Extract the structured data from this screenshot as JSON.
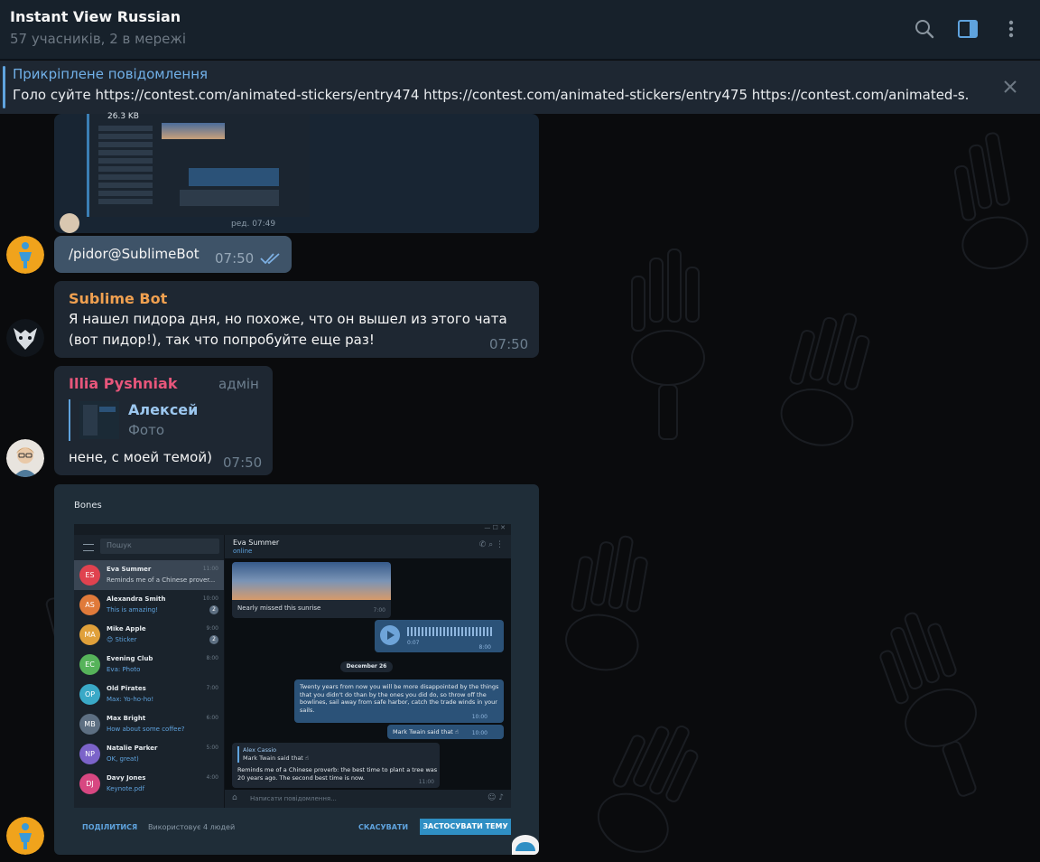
{
  "header": {
    "title": "Instant View Russian",
    "subtitle": "57 учасників, 2 в мережі"
  },
  "pinned": {
    "title": "Прикріплене повідомлення",
    "text": "Голо суйте https://contest.com/animated-stickers/entry474 https://contest.com/animated-stickers/entry475 https://contest.com/animated-s..."
  },
  "top_preview": {
    "size": "26.3 KB",
    "time": "ред. 07:49"
  },
  "messages": {
    "cmd": {
      "text": "/pidor@SublimeBot",
      "time": "07:50"
    },
    "bot": {
      "sender": "Sublime Bot",
      "line1": "Я нашел пидора дня, но похоже, что он вышел из этого чата",
      "line2": "(вот пидор!), так что попробуйте еще раз!",
      "time": "07:50"
    },
    "illia": {
      "sender": "Illia Pyshniak",
      "role": "адмін",
      "reply_name": "Алексей",
      "reply_text": "Фото",
      "text": "нене, с моей темой)",
      "time": "07:50"
    }
  },
  "theme": {
    "name": "Bones",
    "chat_name": "Eva Summer",
    "chat_status": "online",
    "search": "Пошук",
    "compose": "Написати повідомлення...",
    "share": "ПОДІЛИТИСЯ",
    "uses": "Використовує 4 людей",
    "cancel": "СКАСУВАТИ",
    "apply": "ЗАСТОСУВАТИ ТЕМУ",
    "photo_caption": "Nearly missed this sunrise",
    "photo_time": "7:00",
    "voice_len": "0:07",
    "voice_time": "8:00",
    "date": "December 26",
    "long_msg": [
      "Twenty years from now you will be more disappointed by the things",
      "that you didn't do than by the ones you did do, so throw off the",
      "bowlines, sail away from safe harbor, catch the trade winds in your",
      "sails."
    ],
    "long_time": "10:00",
    "mt_msg": "Mark Twain said that ☝",
    "mt_time": "10:00",
    "reply_author": "Alex Cassio",
    "reply_quote": "Mark Twain said that ☝",
    "reply_lines": [
      "Reminds me of a Chinese proverb: the best time to plant a tree was",
      "20 years ago. The second best time is now."
    ],
    "reply_time": "11:00",
    "chats": [
      {
        "initials": "ES",
        "name": "Eva Summer",
        "preview": "Reminds me of a Chinese prover...",
        "time": "11:00",
        "color": "#e0424f",
        "badge": ""
      },
      {
        "initials": "AS",
        "name": "Alexandra Smith",
        "preview": "This is amazing!",
        "time": "10:00",
        "color": "#e07a3a",
        "badge": "2"
      },
      {
        "initials": "MA",
        "name": "Mike Apple",
        "preview": "😊 Sticker",
        "time": "9:00",
        "color": "#e0a03a",
        "badge": "2"
      },
      {
        "initials": "EC",
        "name": "Evening Club",
        "preview": "Eva: Photo",
        "time": "8:00",
        "color": "#56b35a",
        "badge": ""
      },
      {
        "initials": "OP",
        "name": "Old Pirates",
        "preview": "Max: Yo-ho-ho!",
        "time": "7:00",
        "color": "#3aa9c7",
        "badge": ""
      },
      {
        "initials": "MB",
        "name": "Max Bright",
        "preview": "How about some coffee?",
        "time": "6:00",
        "color": "#5d6f82",
        "badge": ""
      },
      {
        "initials": "NP",
        "name": "Natalie Parker",
        "preview": "OK, great)",
        "time": "5:00",
        "color": "#7b63c9",
        "badge": ""
      },
      {
        "initials": "DJ",
        "name": "Davy Jones",
        "preview": "Keynote.pdf",
        "time": "4:00",
        "color": "#d74781",
        "badge": ""
      }
    ]
  },
  "colors": {
    "accent": "#5fa3de",
    "bubble_in": "#182533",
    "bubble_out": "#2b5278",
    "bot_name": "#f0a050",
    "illia_name": "#e8567b"
  }
}
